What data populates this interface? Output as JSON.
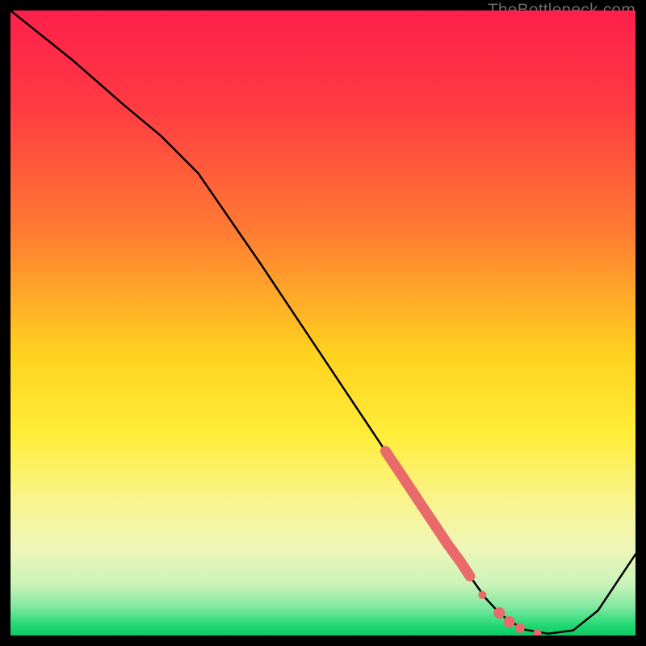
{
  "watermark": "TheBottleneck.com",
  "chart_data": {
    "type": "line",
    "title": "",
    "xlabel": "",
    "ylabel": "",
    "xlim": [
      0,
      100
    ],
    "ylim": [
      0,
      100
    ],
    "gradient_stops": [
      {
        "offset": 0,
        "color": "#ff1f4b"
      },
      {
        "offset": 0.15,
        "color": "#ff3a42"
      },
      {
        "offset": 0.35,
        "color": "#ff7a33"
      },
      {
        "offset": 0.55,
        "color": "#ffd21f"
      },
      {
        "offset": 0.68,
        "color": "#ffed3a"
      },
      {
        "offset": 0.78,
        "color": "#f9f48a"
      },
      {
        "offset": 0.86,
        "color": "#eef7b8"
      },
      {
        "offset": 0.92,
        "color": "#c9f2b8"
      },
      {
        "offset": 0.955,
        "color": "#7de8a0"
      },
      {
        "offset": 0.985,
        "color": "#1fd872"
      },
      {
        "offset": 1.0,
        "color": "#0fc963"
      }
    ],
    "series": [
      {
        "name": "curve",
        "x": [
          0,
          10,
          18,
          24,
          30,
          40,
          50,
          60,
          66,
          70,
          73.5,
          76,
          78.5,
          82,
          86,
          90,
          94,
          100
        ],
        "y": [
          100,
          92,
          85,
          80,
          74,
          59.5,
          44.5,
          29.5,
          20.5,
          14.5,
          9.5,
          6,
          3.3,
          1,
          0.3,
          0.8,
          4,
          13
        ]
      }
    ],
    "highlight_segment": {
      "name": "thick-red-segment",
      "color": "#e86a6a",
      "x": [
        60,
        62,
        64,
        66,
        68,
        70,
        72,
        73.5
      ],
      "y": [
        29.5,
        26.5,
        23.5,
        20.5,
        17.5,
        14.5,
        11.8,
        9.5
      ]
    },
    "highlight_points": [
      {
        "x": 75.5,
        "y": 6.5,
        "color": "#e86a6a",
        "r": 5
      },
      {
        "x": 78.2,
        "y": 3.6,
        "color": "#e86a6a",
        "r": 7
      },
      {
        "x": 79.8,
        "y": 2.2,
        "color": "#e86a6a",
        "r": 7
      },
      {
        "x": 81.5,
        "y": 1.2,
        "color": "#e86a6a",
        "r": 6
      },
      {
        "x": 84.3,
        "y": 0.4,
        "color": "#e86a6a",
        "r": 5
      }
    ]
  }
}
